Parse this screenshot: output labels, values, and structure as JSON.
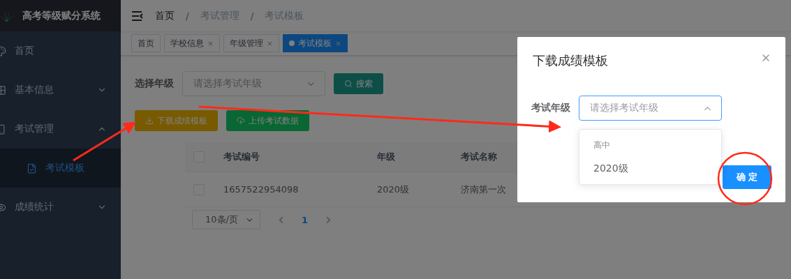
{
  "sidebar": {
    "title": "高考等级赋分系统",
    "items": [
      {
        "label": "首页",
        "kind": "link",
        "selected": false
      },
      {
        "label": "基本信息",
        "kind": "submenu",
        "expanded": false
      },
      {
        "label": "考试管理",
        "kind": "submenu",
        "expanded": true,
        "children": [
          {
            "label": "考试模板",
            "kind": "link",
            "selected": true
          }
        ]
      },
      {
        "label": "成绩统计",
        "kind": "submenu",
        "expanded": false
      }
    ]
  },
  "navbar": {
    "breadcrumbs": [
      "首页",
      "考试管理",
      "考试模板"
    ],
    "separator": "/"
  },
  "tags": [
    {
      "label": "首页",
      "selected": false,
      "closable": false
    },
    {
      "label": "学校信息",
      "selected": false,
      "closable": true
    },
    {
      "label": "年级管理",
      "selected": false,
      "closable": true
    },
    {
      "label": "考试模板",
      "selected": true,
      "closable": true
    }
  ],
  "filter": {
    "label": "选择年级",
    "placeholder": "请选择考试年级",
    "search_button": "搜索"
  },
  "actions": [
    {
      "label": "下载成绩模板",
      "kind": "download"
    },
    {
      "label": "上传考试数据",
      "kind": "upload"
    }
  ],
  "table": {
    "header_checked": false,
    "columns": [
      "考试编号",
      "年级",
      "考试名称"
    ],
    "rows": [
      {
        "checked": false,
        "cells": [
          "1657522954098",
          "2020级",
          "济南第一次"
        ]
      }
    ]
  },
  "pagination": {
    "page_size": "10条/页",
    "pages": [
      {
        "label": "1",
        "selected": true
      }
    ]
  },
  "dialog": {
    "title": "下载成绩模板",
    "field_label": "考试年级",
    "placeholder": "请选择考试年级",
    "dropdown_open": true,
    "groups": [
      {
        "label": "高中",
        "options": [
          {
            "label": "2020级",
            "selected": false
          }
        ]
      }
    ],
    "confirm": "确 定"
  }
}
